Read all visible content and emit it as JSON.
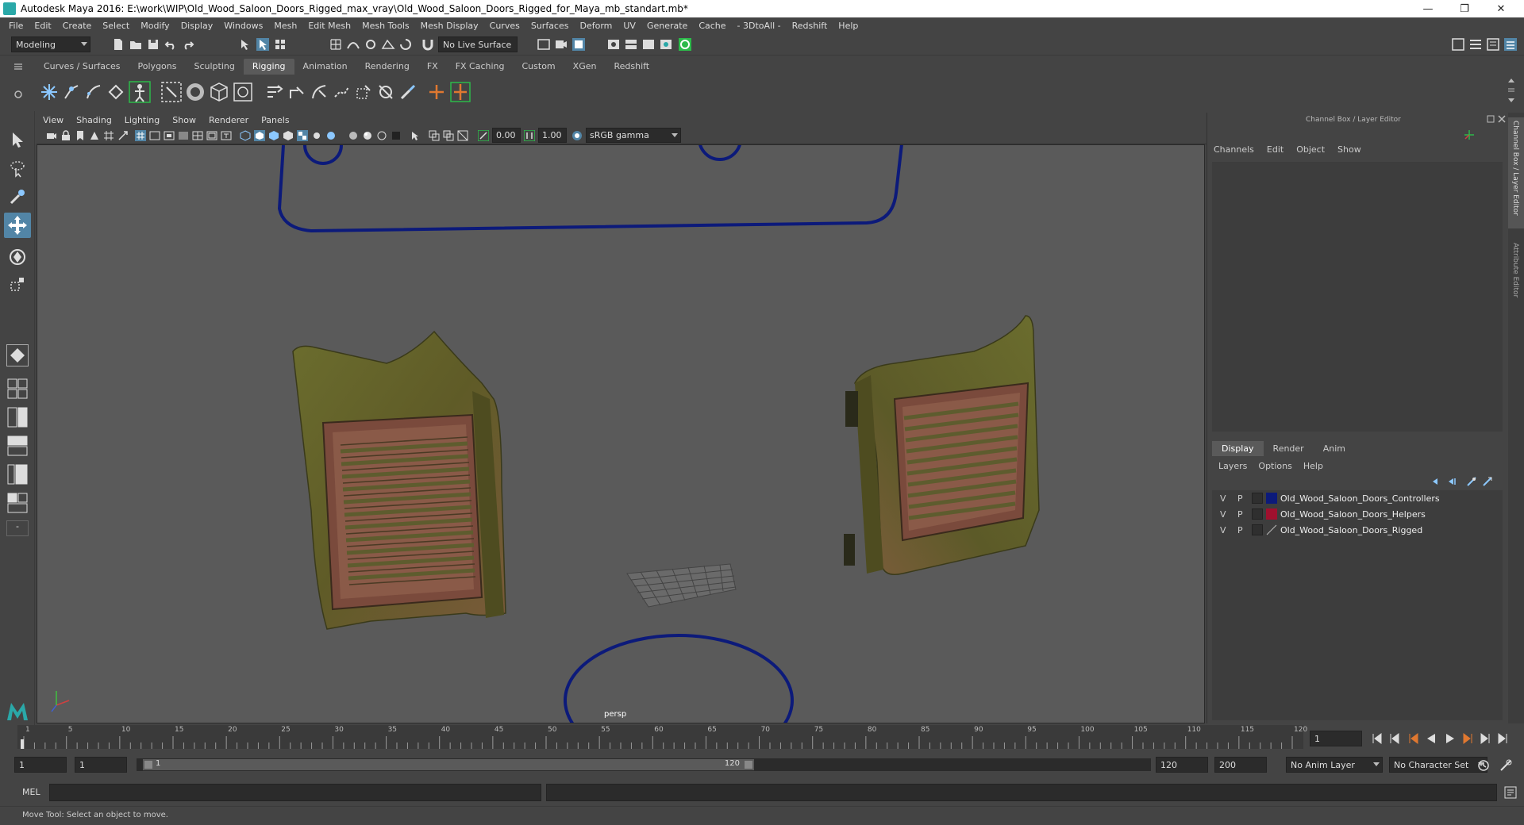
{
  "window": {
    "title": "Autodesk Maya 2016: E:\\work\\WIP\\Old_Wood_Saloon_Doors_Rigged_max_vray\\Old_Wood_Saloon_Doors_Rigged_for_Maya_mb_standart.mb*",
    "minimize": "—",
    "maximize": "❐",
    "close": "✕"
  },
  "menubar": [
    "File",
    "Edit",
    "Create",
    "Select",
    "Modify",
    "Display",
    "Windows",
    "Mesh",
    "Edit Mesh",
    "Mesh Tools",
    "Mesh Display",
    "Curves",
    "Surfaces",
    "Deform",
    "UV",
    "Generate",
    "Cache",
    "- 3DtoAll -",
    "Redshift",
    "Help"
  ],
  "statusline": {
    "mode": "Modeling",
    "live_surface": "No Live Surface"
  },
  "shelf": {
    "tabs": [
      "Curves / Surfaces",
      "Polygons",
      "Sculpting",
      "Rigging",
      "Animation",
      "Rendering",
      "FX",
      "FX Caching",
      "Custom",
      "XGen",
      "Redshift"
    ],
    "active_tab": "Rigging"
  },
  "viewport": {
    "menus": [
      "View",
      "Shading",
      "Lighting",
      "Show",
      "Renderer",
      "Panels"
    ],
    "exposure": "0.00",
    "gamma": "1.00",
    "color_space": "sRGB gamma",
    "camera_label": "persp"
  },
  "channel_box": {
    "title": "Channel Box / Layer Editor",
    "menus": [
      "Channels",
      "Edit",
      "Object",
      "Show"
    ]
  },
  "layer_editor": {
    "tabs": [
      "Display",
      "Render",
      "Anim"
    ],
    "active_tab": "Display",
    "menus": [
      "Layers",
      "Options",
      "Help"
    ],
    "layers": [
      {
        "v": "V",
        "p": "P",
        "color": "#0c1a7a",
        "name": "Old_Wood_Saloon_Doors_Controllers"
      },
      {
        "v": "V",
        "p": "P",
        "color": "#a0102e",
        "name": "Old_Wood_Saloon_Doors_Helpers"
      },
      {
        "v": "V",
        "p": "P",
        "color": "",
        "name": "Old_Wood_Saloon_Doors_Rigged"
      }
    ]
  },
  "side_tabs": [
    "Channel Box / Layer Editor",
    "Attribute Editor"
  ],
  "timeline": {
    "ticks": [
      "1",
      "5",
      "10",
      "15",
      "20",
      "25",
      "30",
      "35",
      "40",
      "45",
      "50",
      "55",
      "60",
      "65",
      "70",
      "75",
      "80",
      "85",
      "90",
      "95",
      "100",
      "105",
      "110",
      "115",
      "120"
    ],
    "current_frame": "1"
  },
  "range": {
    "start": "1",
    "playback_start": "1",
    "range_start_label": "1",
    "range_end_label": "120",
    "playback_end": "120",
    "end": "200",
    "anim_layer": "No Anim Layer",
    "character_set": "No Character Set"
  },
  "command_line": {
    "label": "MEL"
  },
  "help_line": "Move Tool: Select an object to move.",
  "colors": {
    "controller_blue": "#0c1a7a",
    "helper_red": "#a0102e",
    "accent_teal": "#2aa8a8"
  }
}
